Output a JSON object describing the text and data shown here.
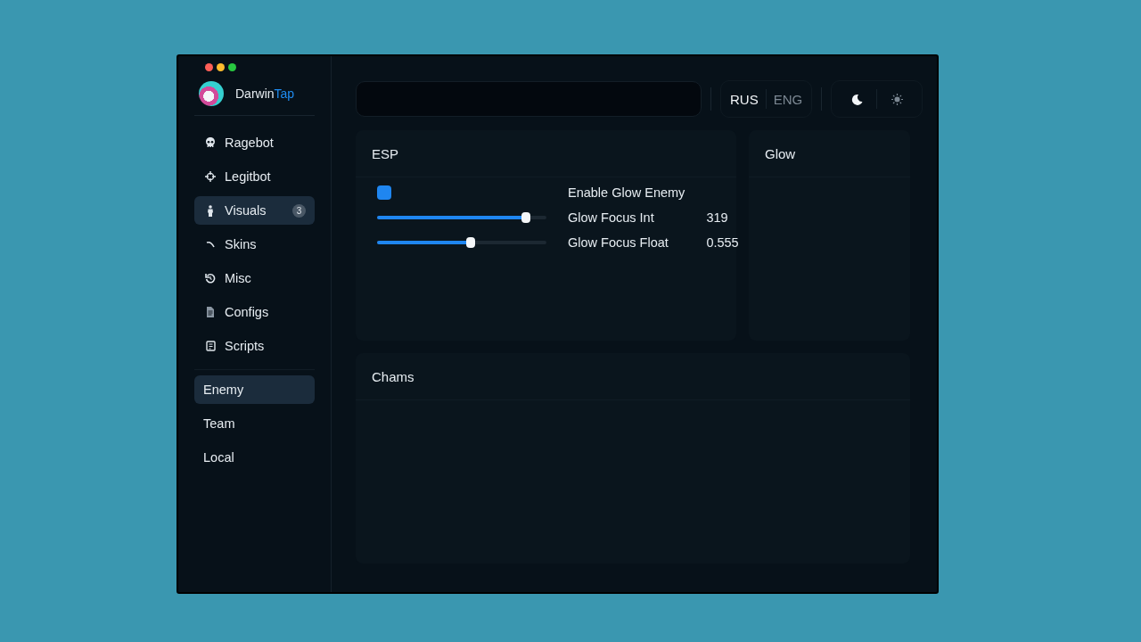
{
  "sidebar": {
    "logo": {
      "text": "Darwin",
      "accent": "Tap"
    },
    "items": [
      {
        "label": "Ragebot",
        "selected": false
      },
      {
        "label": "Legitbot",
        "selected": false
      },
      {
        "label": "Visuals",
        "selected": true,
        "badge": "3"
      },
      {
        "label": "Skins",
        "selected": false
      },
      {
        "label": "Misc",
        "selected": false
      },
      {
        "label": "Configs",
        "selected": false
      },
      {
        "label": "Scripts",
        "selected": false
      }
    ],
    "sub_items": [
      {
        "label": "Enemy",
        "selected": true
      },
      {
        "label": "Team",
        "selected": false
      },
      {
        "label": "Local",
        "selected": false
      }
    ]
  },
  "topbar": {
    "languages": [
      {
        "label": "RUS",
        "selected": true
      },
      {
        "label": "ENG",
        "selected": false
      }
    ],
    "themes": [
      {
        "kind": "dark",
        "selected": true
      },
      {
        "kind": "light",
        "selected": false
      }
    ]
  },
  "panels": [
    {
      "title": "ESP",
      "rows": [
        {
          "kind": "checkbox",
          "label": "Enable Glow Enemy",
          "checked": true
        },
        {
          "kind": "slider",
          "label": "Glow Focus Int",
          "level": 0.88,
          "reading": "319"
        },
        {
          "kind": "slider",
          "label": "Glow Focus Float",
          "level": 0.55,
          "reading": "0.555"
        }
      ]
    },
    {
      "title": "Glow"
    },
    {
      "title": "Chams"
    }
  ]
}
